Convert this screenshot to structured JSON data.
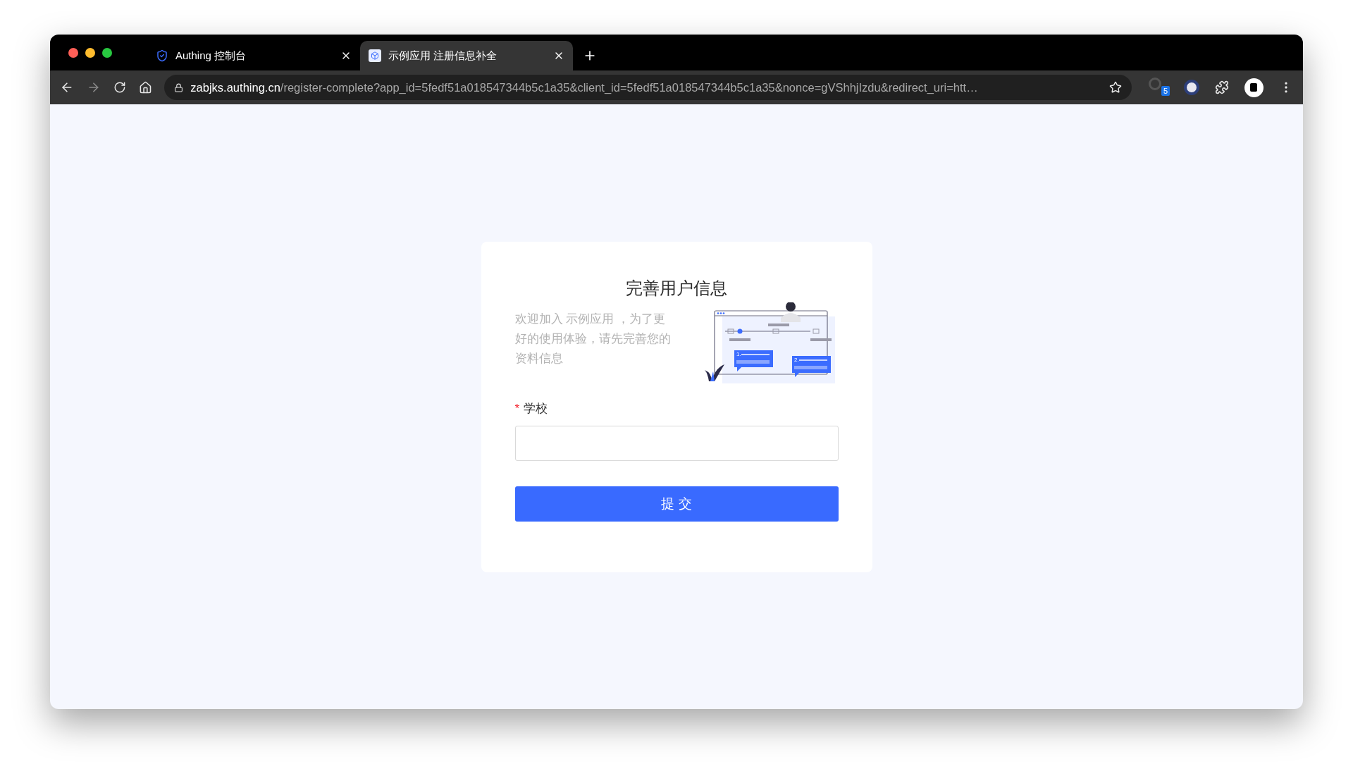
{
  "browser": {
    "tabs": [
      {
        "title": "Authing 控制台",
        "selected": false
      },
      {
        "title": "示例应用 注册信息补全",
        "selected": true
      }
    ],
    "address_bar": {
      "host": "zabjks.authing.cn",
      "path": "/register-complete?app_id=5fedf51a018547344b5c1a35&client_id=5fedf51a018547344b5c1a35&nonce=gVShhjIzdu&redirect_uri=htt…"
    },
    "extension_badge": "5"
  },
  "form": {
    "title": "完善用户信息",
    "intro": "欢迎加入 示例应用 ，为了更好的使用体验，请先完善您的资料信息",
    "illustration": {
      "step_labels": [
        "1.",
        "2."
      ]
    },
    "required_mark": "*",
    "fields": [
      {
        "label": "学校",
        "required": true
      }
    ],
    "submit": "提 交"
  }
}
